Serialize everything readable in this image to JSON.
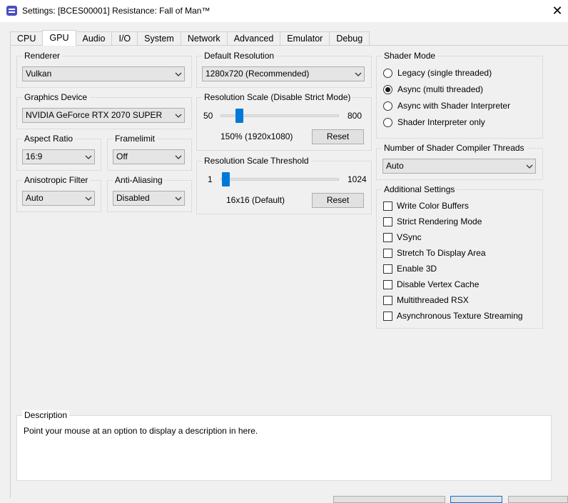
{
  "window": {
    "title": "Settings: [BCES00001] Resistance: Fall of Man™",
    "close_glyph": "✕"
  },
  "tabs": [
    {
      "label": "CPU"
    },
    {
      "label": "GPU"
    },
    {
      "label": "Audio"
    },
    {
      "label": "I/O"
    },
    {
      "label": "System"
    },
    {
      "label": "Network"
    },
    {
      "label": "Advanced"
    },
    {
      "label": "Emulator"
    },
    {
      "label": "Debug"
    }
  ],
  "active_tab": "GPU",
  "renderer": {
    "label": "Renderer",
    "value": "Vulkan"
  },
  "graphics_device": {
    "label": "Graphics Device",
    "value": "NVIDIA GeForce RTX 2070 SUPER"
  },
  "aspect_ratio": {
    "label": "Aspect Ratio",
    "value": "16:9"
  },
  "framelimit": {
    "label": "Framelimit",
    "value": "Off"
  },
  "anisotropic_filter": {
    "label": "Anisotropic Filter",
    "value": "Auto"
  },
  "anti_aliasing": {
    "label": "Anti-Aliasing",
    "value": "Disabled"
  },
  "default_resolution": {
    "label": "Default Resolution",
    "value": "1280x720 (Recommended)"
  },
  "resolution_scale": {
    "label": "Resolution Scale (Disable Strict Mode)",
    "min": "50",
    "max": "800",
    "value_text": "150% (1920x1080)",
    "value": 150,
    "reset_label": "Reset"
  },
  "resolution_threshold": {
    "label": "Resolution Scale Threshold",
    "min": "1",
    "max": "1024",
    "value_text": "16x16 (Default)",
    "value": 16,
    "reset_label": "Reset"
  },
  "shader_mode": {
    "label": "Shader Mode",
    "options": [
      {
        "label": "Legacy (single threaded)",
        "checked": false
      },
      {
        "label": "Async (multi threaded)",
        "checked": true
      },
      {
        "label": "Async with Shader Interpreter",
        "checked": false
      },
      {
        "label": "Shader Interpreter only",
        "checked": false
      }
    ]
  },
  "shader_threads": {
    "label": "Number of Shader Compiler Threads",
    "value": "Auto"
  },
  "additional_settings": {
    "label": "Additional Settings",
    "items": [
      {
        "label": "Write Color Buffers",
        "checked": false
      },
      {
        "label": "Strict Rendering Mode",
        "checked": false
      },
      {
        "label": "VSync",
        "checked": false
      },
      {
        "label": "Stretch To Display Area",
        "checked": false
      },
      {
        "label": "Enable 3D",
        "checked": false
      },
      {
        "label": "Disable Vertex Cache",
        "checked": false
      },
      {
        "label": "Multithreaded RSX",
        "checked": false
      },
      {
        "label": "Asynchronous Texture Streaming",
        "checked": false
      }
    ]
  },
  "description": {
    "label": "Description",
    "text": "Point your mouse at an option to display a description in here."
  },
  "icons": {
    "app": "rpcs3-app-icon",
    "close": "close-icon",
    "dropdown": "chevron-down-icon"
  },
  "colors": {
    "accent": "#0078d7",
    "background": "#f0f0f0",
    "titlebar": "#ffffff"
  }
}
